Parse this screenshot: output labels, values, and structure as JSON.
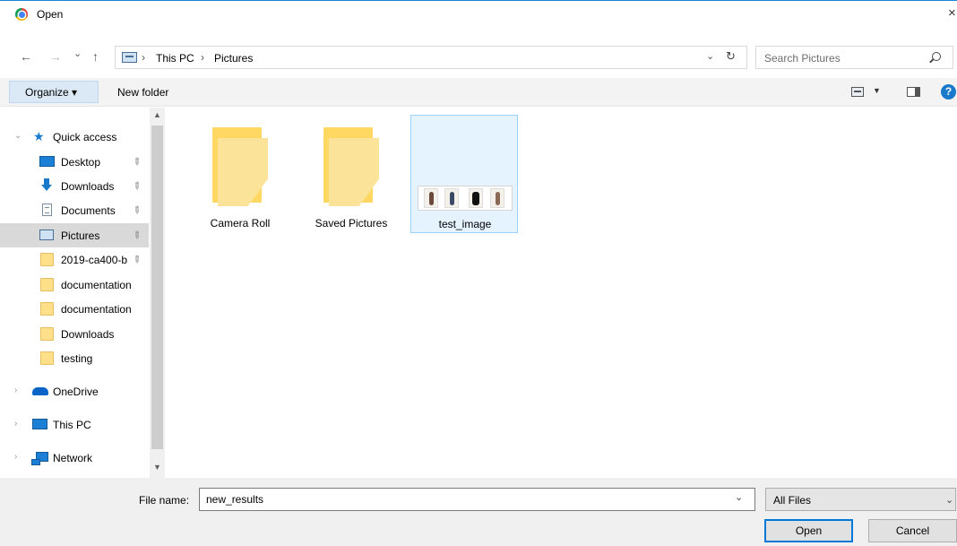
{
  "window": {
    "title": "Open",
    "close_glyph": "×"
  },
  "nav": {
    "back_glyph": "←",
    "forward_glyph": "→",
    "recent_glyph": "⌄",
    "up_glyph": "↑"
  },
  "address": {
    "crumbs": [
      "This PC",
      "Pictures"
    ],
    "separator": "›",
    "dropdown_glyph": "⌄",
    "refresh_glyph": "↻"
  },
  "search": {
    "placeholder": "Search Pictures"
  },
  "toolbar": {
    "organize_label": "Organize ▾",
    "new_folder_label": "New folder",
    "view_dropdown_glyph": "▼",
    "help_glyph": "?"
  },
  "sidebar": {
    "quick_access": "Quick access",
    "items": [
      {
        "label": "Desktop"
      },
      {
        "label": "Downloads"
      },
      {
        "label": "Documents"
      },
      {
        "label": "Pictures"
      },
      {
        "label": "2019-ca400-b"
      },
      {
        "label": "documentation"
      },
      {
        "label": "documentation"
      },
      {
        "label": "Downloads"
      },
      {
        "label": "testing"
      }
    ],
    "onedrive": "OneDrive",
    "this_pc": "This PC",
    "network": "Network",
    "expander_open": "⌄",
    "expander_closed": "›",
    "pin_glyph": "📌"
  },
  "files": [
    {
      "name": "Camera Roll"
    },
    {
      "name": "Saved Pictures"
    },
    {
      "name": "test_image"
    }
  ],
  "footer": {
    "file_name_label": "File name:",
    "file_name_value": "new_results",
    "filter_value": "All Files",
    "dropdown_glyph": "⌄",
    "open_label": "Open",
    "cancel_label": "Cancel"
  },
  "scrollbar": {
    "up_glyph": "▲",
    "down_glyph": "▼"
  }
}
